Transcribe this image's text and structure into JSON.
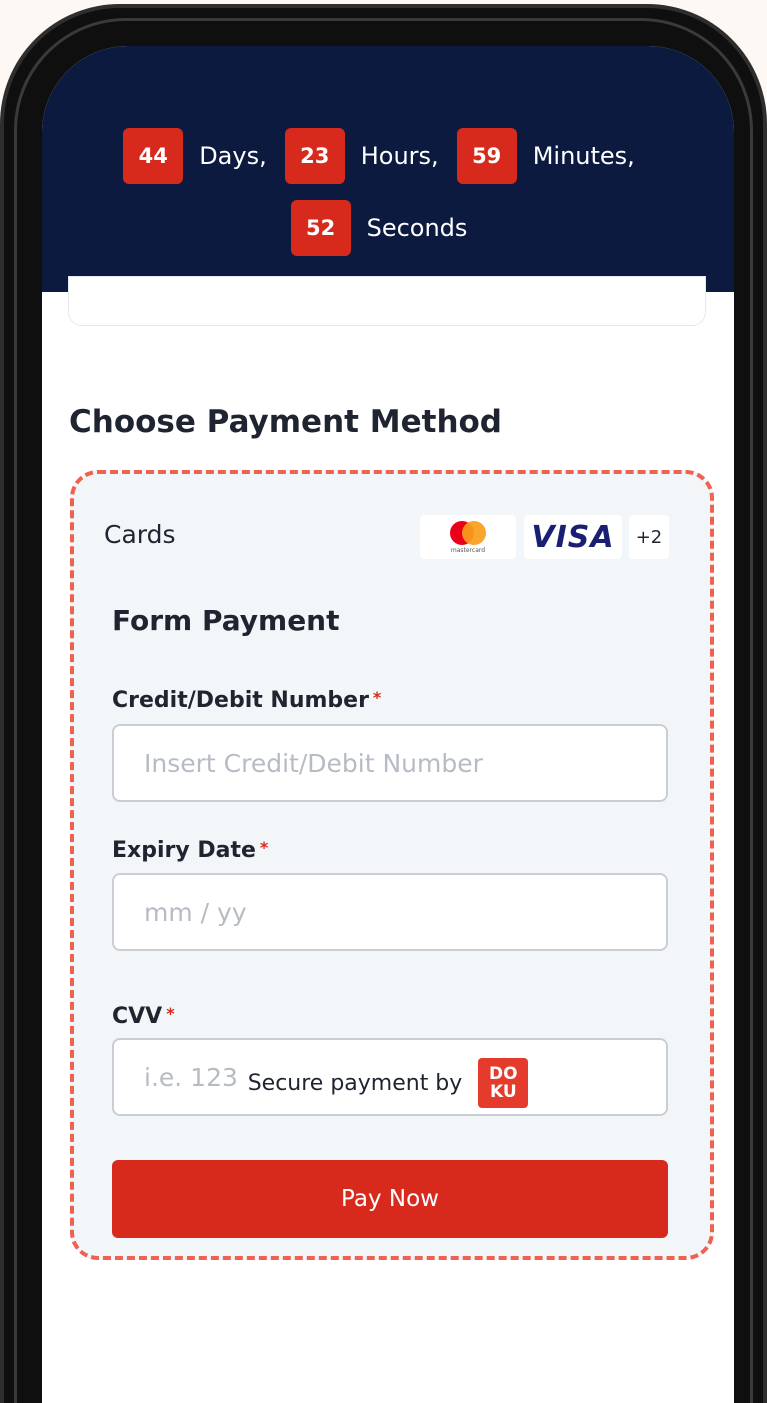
{
  "countdown": {
    "days_value": "44",
    "days_label": "Days,",
    "hours_value": "23",
    "hours_label": "Hours,",
    "minutes_value": "59",
    "minutes_label": "Minutes,",
    "seconds_value": "52",
    "seconds_label": "Seconds"
  },
  "payment": {
    "section_title": "Choose Payment Method",
    "cards_label": "Cards",
    "mastercard_text": "mastercard",
    "visa_text": "VISA",
    "more_brands": "+2",
    "form_title": "Form Payment",
    "card_number_label": "Credit/Debit Number",
    "card_number_placeholder": "Insert Credit/Debit Number",
    "expiry_label": "Expiry Date",
    "expiry_placeholder": "mm / yy",
    "cvv_label": "CVV",
    "cvv_placeholder": "i.e. 123",
    "required_mark": "*",
    "pay_button": "Pay Now"
  },
  "footer": {
    "secure_text": "Secure payment by",
    "logo_top": "DO",
    "logo_bottom": "KU"
  },
  "colors": {
    "countdown_bg": "#0c1a3f",
    "accent_red": "#d7291c",
    "dashed_border": "#ef6251"
  }
}
